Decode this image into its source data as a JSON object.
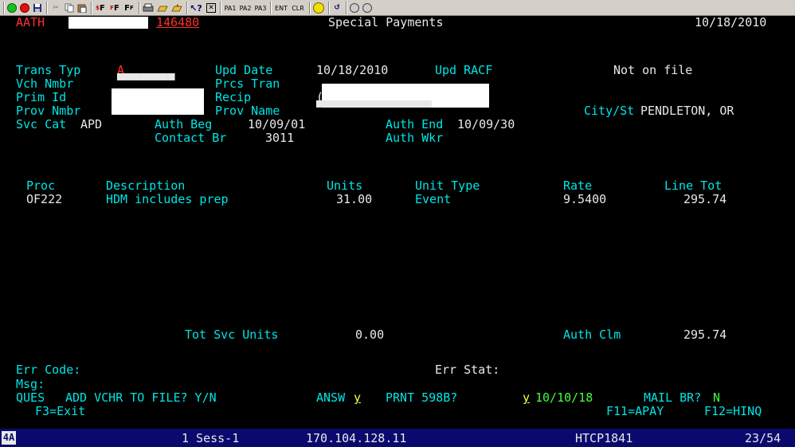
{
  "toolbar": {
    "buttons": [
      "circle-green",
      "circle-red",
      "save",
      "cut",
      "copy",
      "paste",
      "font-large",
      "font-medium",
      "font-small",
      "print",
      "send",
      "receive",
      "help",
      "close"
    ],
    "pa1": "PA1",
    "pa2": "PA2",
    "pa3": "PA3",
    "ent": "ENT",
    "clr": "CLR"
  },
  "header": {
    "screen_id": "AATH",
    "auth_number": "146480",
    "title": "Special Payments",
    "date": "10/18/2010"
  },
  "form": {
    "trans_typ_label": "Trans Typ",
    "trans_typ_value": "A",
    "upd_date_label": "Upd Date",
    "upd_date_value": "10/18/2010",
    "upd_racf_label": "Upd RACF",
    "status_text": "Not on file",
    "vch_nmbr_label": "Vch Nmbr",
    "prcs_tran_label": "Prcs Tran",
    "prim_id_label": "Prim Id",
    "recip_label": "Recip",
    "prov_nmbr_label": "Prov Nmbr",
    "prov_name_label": "Prov Name",
    "city_st_label": "City/St",
    "city_st_value": "PENDLETON, OR",
    "svc_cat_label": "Svc Cat",
    "svc_cat_value": "APD",
    "auth_beg_label": "Auth Beg",
    "auth_beg_value": "10/09/01",
    "auth_end_label": "Auth End",
    "auth_end_value": "10/09/30",
    "contact_br_label": "Contact Br",
    "contact_br_value": "3011",
    "auth_wkr_label": "Auth Wkr"
  },
  "lines": {
    "headers": {
      "proc": "Proc",
      "description": "Description",
      "units": "Units",
      "unit_type": "Unit Type",
      "rate": "Rate",
      "line_tot": "Line Tot"
    },
    "rows": [
      {
        "proc": "OF222",
        "description": "HDM includes prep",
        "units": "31.00",
        "unit_type": "Event",
        "rate": "9.5400",
        "line_tot": "295.74"
      }
    ]
  },
  "totals": {
    "tot_svc_units_label": "Tot Svc Units",
    "tot_svc_units_value": "0.00",
    "auth_clm_label": "Auth Clm",
    "auth_clm_value": "295.74"
  },
  "messages": {
    "err_code_label": "Err Code:",
    "err_stat_label": "Err Stat:",
    "msg_label": "Msg:"
  },
  "prompt": {
    "ques_label": "QUES",
    "question": "ADD VCHR TO FILE? Y/N",
    "answ_label": "ANSW",
    "answ_value": "y",
    "prnt_label": "PRNT 598B?",
    "prnt_value": "y",
    "prnt_date": "10/10/18",
    "mail_label": "MAIL BR?",
    "mail_value": "N"
  },
  "function_keys": {
    "f3": "F3=Exit",
    "f11": "F11=APAY",
    "f12": "F12=HINQ"
  },
  "statusbar": {
    "indicator": "4A",
    "session": "1 Sess-1",
    "ip": "170.104.128.11",
    "host": "HTCP1841",
    "cursor": "23/54"
  }
}
